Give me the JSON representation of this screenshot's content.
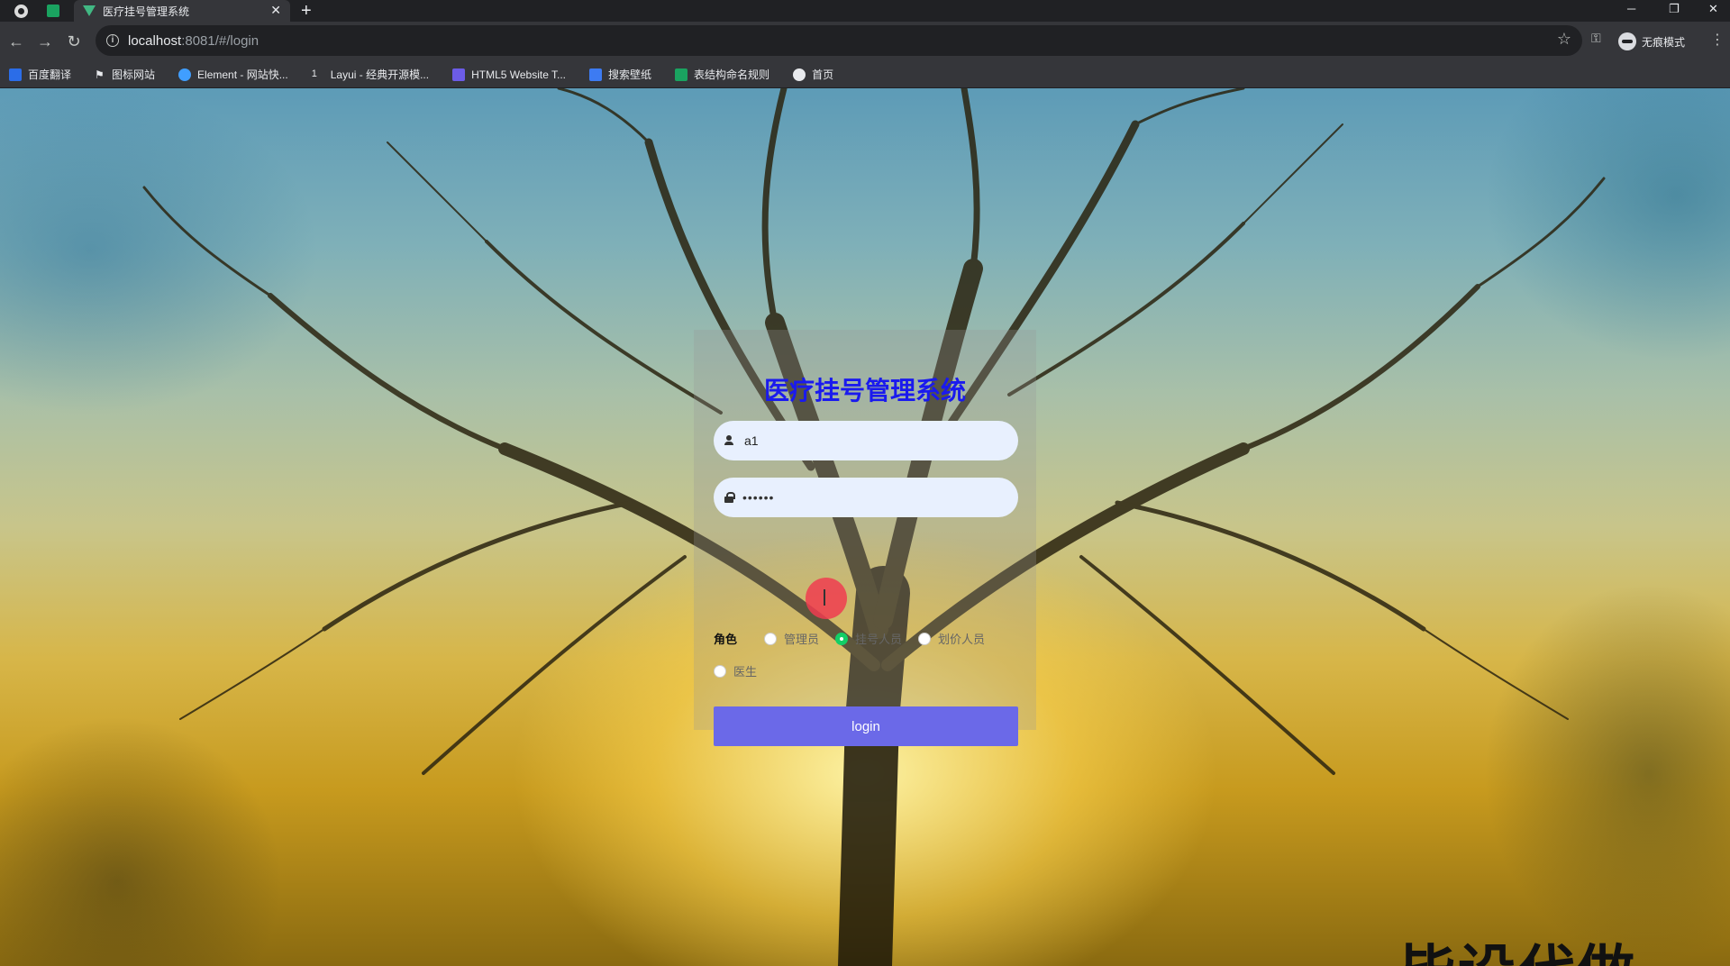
{
  "browser": {
    "tab_title": "医疗挂号管理系统",
    "tab_close": "✕",
    "new_tab": "+",
    "url_host": "localhost",
    "url_rest": ":8081/#/login",
    "incognito_label": "无痕模式",
    "bookmarks": [
      {
        "label": "百度翻译",
        "color": "#2b6de8"
      },
      {
        "label": "图标网站",
        "color": "#e8eaed"
      },
      {
        "label": "Element - 网站快...",
        "color": "#409eff"
      },
      {
        "label": "Layui - 经典开源模...",
        "color": "#e8eaed"
      },
      {
        "label": "HTML5 Website T...",
        "color": "#6c5ce7"
      },
      {
        "label": "搜索壁纸",
        "color": "#3d7bf2"
      },
      {
        "label": "表结构命名规则",
        "color": "#1aa360"
      },
      {
        "label": "首页",
        "color": "#e8eaed"
      }
    ]
  },
  "login": {
    "title": "医疗挂号管理系统",
    "username_value": "a1",
    "password_value": "••••••",
    "role_label": "角色",
    "roles": [
      {
        "label": "管理员",
        "checked": false
      },
      {
        "label": "挂号人员",
        "checked": true
      },
      {
        "label": "划价人员",
        "checked": false
      },
      {
        "label": "医生",
        "checked": false
      }
    ],
    "button_label": "login"
  },
  "watermark": "毕设代做",
  "colors": {
    "title": "#1a1aee",
    "button": "#6b69e8",
    "radio_checked": "#13ce66"
  }
}
